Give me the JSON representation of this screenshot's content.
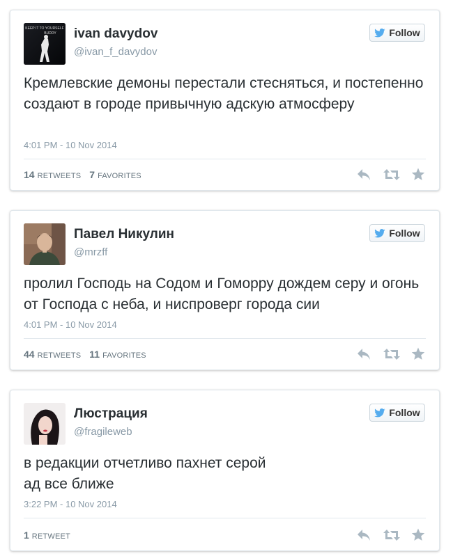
{
  "tweets": [
    {
      "display_name": "ivan davydov",
      "handle": "@ivan_f_davydov",
      "text": "Кремлевские демоны перестали стесняться, и постепенно создают в городе привычную адскую атмосферу",
      "timestamp": "4:01 PM - 10 Nov 2014",
      "retweets_count": "14",
      "retweets_label": "RETWEETS",
      "favorites_count": "7",
      "favorites_label": "FAVORITES",
      "follow_label": "Follow",
      "avatar_text_top": "KEEP IT TO YOURSELF",
      "avatar_text_bottom": "BUDDY"
    },
    {
      "display_name": "Павел Никулин",
      "handle": "@mrzff",
      "text": "пролил Господь на Содом и Гоморру дождем серу и огонь от Господа с неба, и ниспроверг города сии",
      "timestamp": "4:01 PM - 10 Nov 2014",
      "retweets_count": "44",
      "retweets_label": "RETWEETS",
      "favorites_count": "11",
      "favorites_label": "FAVORITES",
      "follow_label": "Follow"
    },
    {
      "display_name": "Люстрация",
      "handle": "@fragileweb",
      "text_line1": "в редакции отчетливо пахнет серой",
      "text_line2": "ад все ближе",
      "timestamp": "3:22 PM - 10 Nov 2014",
      "retweets_count": "1",
      "retweets_label": "RETWEET",
      "follow_label": "Follow"
    }
  ],
  "colors": {
    "twitter_blue": "#55acee",
    "action_icon": "#aab8c2",
    "name": "#292f33",
    "muted": "#8899a6",
    "stats": "#66757f"
  },
  "icons": [
    "twitter-bird-icon",
    "reply-icon",
    "retweet-icon",
    "favorite-star-icon"
  ]
}
